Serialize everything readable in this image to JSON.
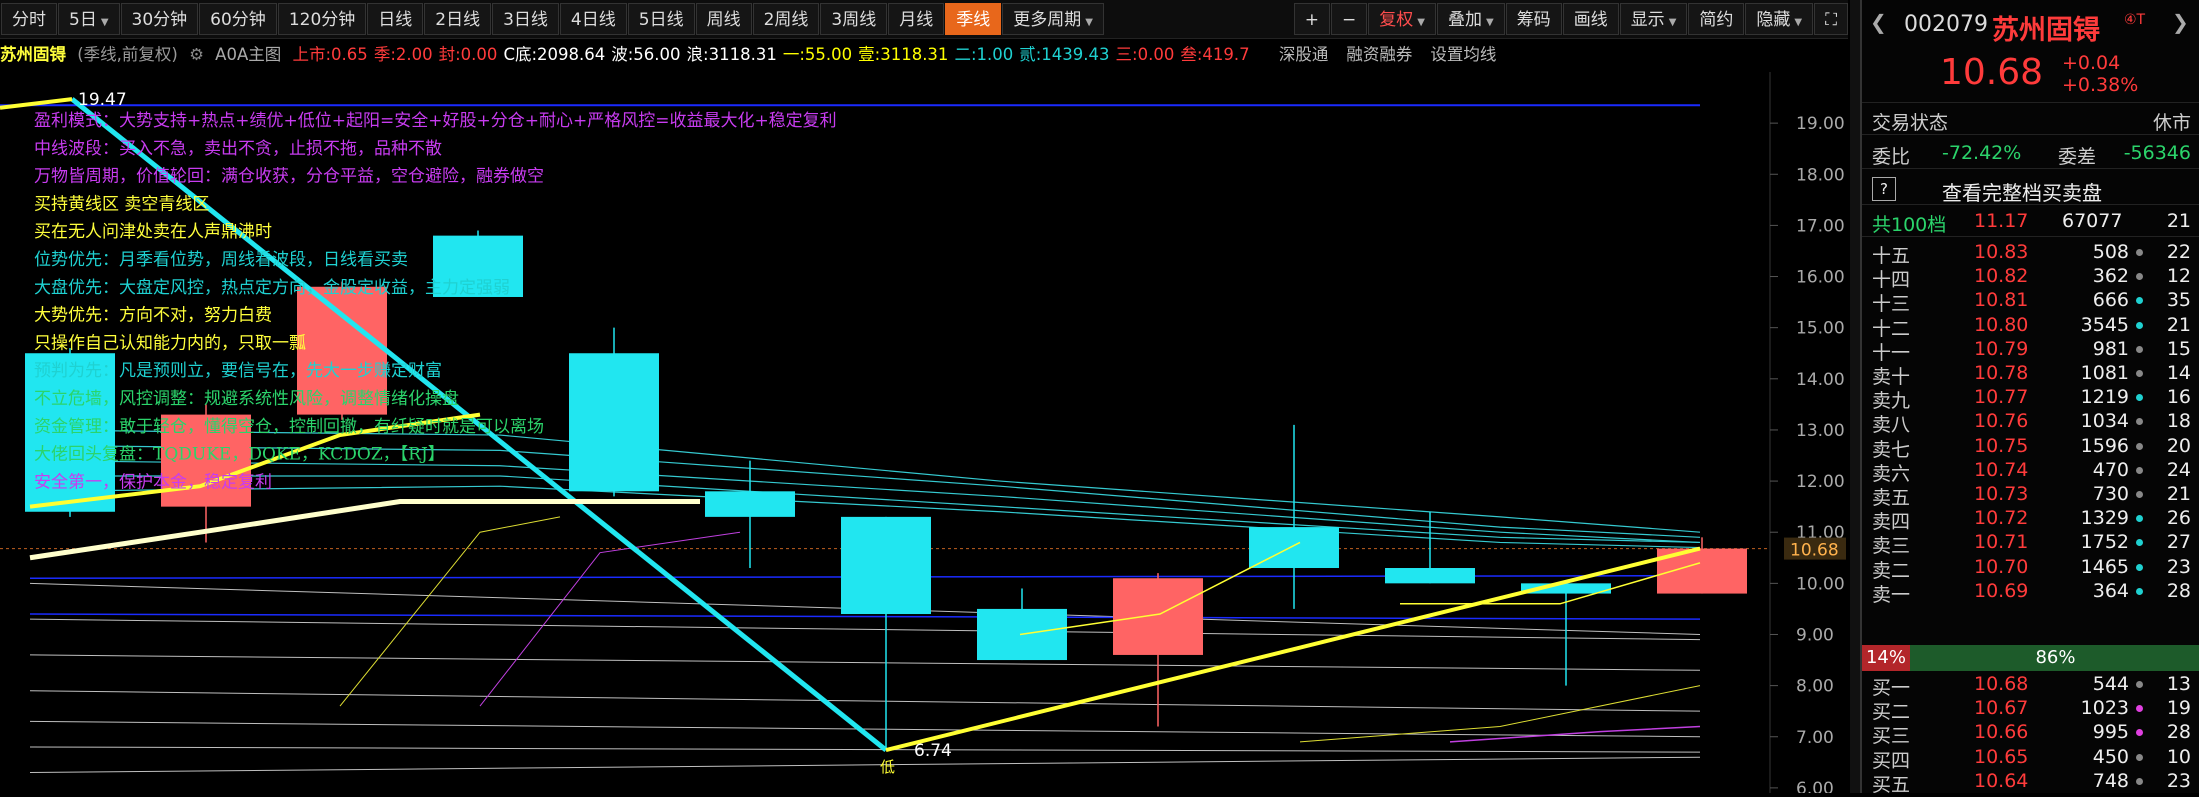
{
  "toolbar": {
    "periods": [
      "分时",
      "5日",
      "30分钟",
      "60分钟",
      "120分钟",
      "日线",
      "2日线",
      "3日线",
      "4日线",
      "5日线",
      "周线",
      "2周线",
      "3周线",
      "月线",
      "季线",
      "更多周期"
    ],
    "active": "季线",
    "tools": [
      "+",
      "−",
      "复权",
      "叠加",
      "筹码",
      "画线",
      "显示",
      "简约",
      "隐藏"
    ],
    "fullscreen_icon": "fullscreen-icon"
  },
  "indicator": {
    "stock_name": "苏州固锝",
    "mode": "(季线,前复权)",
    "gear_icon": "gear-icon",
    "formula": "A0A主图",
    "items": [
      {
        "text": "上市:0.65",
        "color": "#ff3b3b"
      },
      {
        "text": "季:2.00",
        "color": "#ff3b3b"
      },
      {
        "text": "封:0.00",
        "color": "#ff3b3b"
      },
      {
        "text": "C底:2098.64",
        "color": "#ffffff"
      },
      {
        "text": "波:56.00",
        "color": "#ffffff"
      },
      {
        "text": "浪:3118.31",
        "color": "#ffffff"
      },
      {
        "text": "一:55.00",
        "color": "#ffff00"
      },
      {
        "text": "壹:3118.31",
        "color": "#ffff00"
      },
      {
        "text": "二:1.00",
        "color": "#1fd1d1"
      },
      {
        "text": "贰:1439.43",
        "color": "#1fd1d1"
      },
      {
        "text": "三:0.00",
        "color": "#ff3b3b"
      },
      {
        "text": "叁:419.7",
        "color": "#ff3b3b"
      }
    ],
    "links": [
      "深股通",
      "融资融券",
      "设置均线"
    ]
  },
  "chart_data": {
    "type": "candlestick",
    "candles": [
      {
        "o": 11.4,
        "c": 14.5,
        "h": 14.6,
        "l": 11.3,
        "up": false
      },
      {
        "o": 11.5,
        "c": 13.3,
        "h": 13.5,
        "l": 10.8,
        "up": true
      },
      {
        "o": 13.3,
        "c": 15.8,
        "h": 15.9,
        "l": 13.2,
        "up": true
      },
      {
        "o": 15.6,
        "c": 16.8,
        "h": 16.9,
        "l": 15.6,
        "up": false
      },
      {
        "o": 14.5,
        "c": 11.8,
        "h": 15.0,
        "l": 11.7,
        "up": false
      },
      {
        "o": 11.8,
        "c": 11.3,
        "h": 12.4,
        "l": 10.3,
        "up": false
      },
      {
        "o": 11.3,
        "c": 9.4,
        "h": 11.3,
        "l": 6.74,
        "up": false
      },
      {
        "o": 9.5,
        "c": 8.5,
        "h": 9.9,
        "l": 8.5,
        "up": false
      },
      {
        "o": 8.6,
        "c": 10.1,
        "h": 10.2,
        "l": 7.2,
        "up": true
      },
      {
        "o": 11.1,
        "c": 10.3,
        "h": 13.1,
        "l": 9.5,
        "up": false
      },
      {
        "o": 10.3,
        "c": 10.0,
        "h": 11.4,
        "l": 10.0,
        "up": false
      },
      {
        "o": 10.0,
        "c": 9.8,
        "h": 10.0,
        "l": 8.0,
        "up": false
      },
      {
        "o": 9.8,
        "c": 10.68,
        "h": 10.9,
        "l": 9.8,
        "up": true
      }
    ],
    "y_ticks": [
      "19.00",
      "18.00",
      "17.00",
      "16.00",
      "15.00",
      "14.00",
      "13.00",
      "12.00",
      "11.00",
      "10.00",
      "9.00",
      "8.00",
      "7.00",
      "6.00"
    ],
    "ylim": [
      5.9,
      20.0
    ],
    "current_price": "10.68",
    "high_label": "19.47",
    "low_label": "6.74",
    "low_marker": "低",
    "annotations": [
      {
        "text": "盈利模式：大势支持+热点+绩优+低位+起阳=安全+好股+分仓+耐心+严格风控=收益最大化+稳定复利",
        "color": "#c83cf0"
      },
      {
        "text": "中线波段：买入不急，卖出不贪，止损不拖，品种不散",
        "color": "#c83cf0"
      },
      {
        "text": "万物皆周期，价值轮回：满仓收获，分仓平益，空仓避险，融券做空",
        "color": "#c83cf0"
      },
      {
        "text": "买持黄线区    卖空青线区",
        "color": "#ffff3c"
      },
      {
        "text": "买在无人问津处卖在人声鼎沸时",
        "color": "#ffff3c"
      },
      {
        "text": "位势优先：月季看位势，周线看波段，日线看买卖",
        "color": "#1fd1d1"
      },
      {
        "text": "大盘优先：大盘定风控，热点定方向，金股定收益，主力定强弱",
        "color": "#1fd1d1"
      },
      {
        "text": "大势优先：方向不对，努力白费",
        "color": "#ffff3c"
      },
      {
        "text": "只操作自己认知能力内的，只取一瓢",
        "color": "#ffff3c"
      },
      {
        "text": "预判为先：凡是预则立，要信号在，先大一步赚定财富",
        "color": "#1fd1d1"
      },
      {
        "text": "不立危墙，风控调整：规避系统性风险，调整情绪化操盘",
        "color": "#2bd46b"
      },
      {
        "text": "资金管理：敢于轻仓，懂得空仓，控制回撤，有纤疑时就是可以离场",
        "color": "#2bd46b"
      },
      {
        "text": "大佬回头复盘：TQDUKE，DQKE，KCDOZ，【RJ】",
        "color": "#2bd46b"
      },
      {
        "text": "安全第一，保护本金，稳定复利",
        "color": "#c83cf0"
      }
    ]
  },
  "panel": {
    "code": "002079",
    "name": "苏州固锝",
    "tag": "④T",
    "price": "10.68",
    "change": "+0.04",
    "change_pct": "+0.38%",
    "status_label": "交易状态",
    "status_value": "休市",
    "weibi_label": "委比",
    "weibi_value": "-72.42%",
    "weicha_label": "委差",
    "weicha_value": "-56346",
    "orderbook_button": "查看完整档买卖盘",
    "help_icon": "?",
    "total_label": "共100档",
    "total_price": "11.17",
    "total_vol": "67077",
    "total_count": "21",
    "asks": [
      {
        "label": "十五",
        "price": "10.83",
        "vol": "508",
        "dot": "#888",
        "count": "22"
      },
      {
        "label": "十四",
        "price": "10.82",
        "vol": "362",
        "dot": "#888",
        "count": "12"
      },
      {
        "label": "十三",
        "price": "10.81",
        "vol": "666",
        "dot": "#1fd1d1",
        "count": "35"
      },
      {
        "label": "十二",
        "price": "10.80",
        "vol": "3545",
        "dot": "#1fd1d1",
        "count": "21"
      },
      {
        "label": "十一",
        "price": "10.79",
        "vol": "981",
        "dot": "#888",
        "count": "15"
      },
      {
        "label": "卖十",
        "price": "10.78",
        "vol": "1081",
        "dot": "#888",
        "count": "14"
      },
      {
        "label": "卖九",
        "price": "10.77",
        "vol": "1219",
        "dot": "#1fd1d1",
        "count": "16"
      },
      {
        "label": "卖八",
        "price": "10.76",
        "vol": "1034",
        "dot": "#888",
        "count": "18"
      },
      {
        "label": "卖七",
        "price": "10.75",
        "vol": "1596",
        "dot": "#888",
        "count": "20"
      },
      {
        "label": "卖六",
        "price": "10.74",
        "vol": "470",
        "dot": "#888",
        "count": "24"
      },
      {
        "label": "卖五",
        "price": "10.73",
        "vol": "730",
        "dot": "#888",
        "count": "21"
      },
      {
        "label": "卖四",
        "price": "10.72",
        "vol": "1329",
        "dot": "#1fd1d1",
        "count": "26"
      },
      {
        "label": "卖三",
        "price": "10.71",
        "vol": "1752",
        "dot": "#1fd1d1",
        "count": "27"
      },
      {
        "label": "卖二",
        "price": "10.70",
        "vol": "1465",
        "dot": "#1fd1d1",
        "count": "23"
      },
      {
        "label": "卖一",
        "price": "10.69",
        "vol": "364",
        "dot": "#1fd1d1",
        "count": "28"
      }
    ],
    "ratio_buy": "14%",
    "ratio_sell": "86%",
    "bids": [
      {
        "label": "买一",
        "price": "10.68",
        "vol": "544",
        "dot": "#888",
        "count": "13"
      },
      {
        "label": "买二",
        "price": "10.67",
        "vol": "1023",
        "dot": "#e040e0",
        "count": "19"
      },
      {
        "label": "买三",
        "price": "10.66",
        "vol": "995",
        "dot": "#e040e0",
        "count": "28"
      },
      {
        "label": "买四",
        "price": "10.65",
        "vol": "450",
        "dot": "#888",
        "count": "10"
      },
      {
        "label": "买五",
        "price": "10.64",
        "vol": "748",
        "dot": "#888",
        "count": "23"
      }
    ]
  }
}
